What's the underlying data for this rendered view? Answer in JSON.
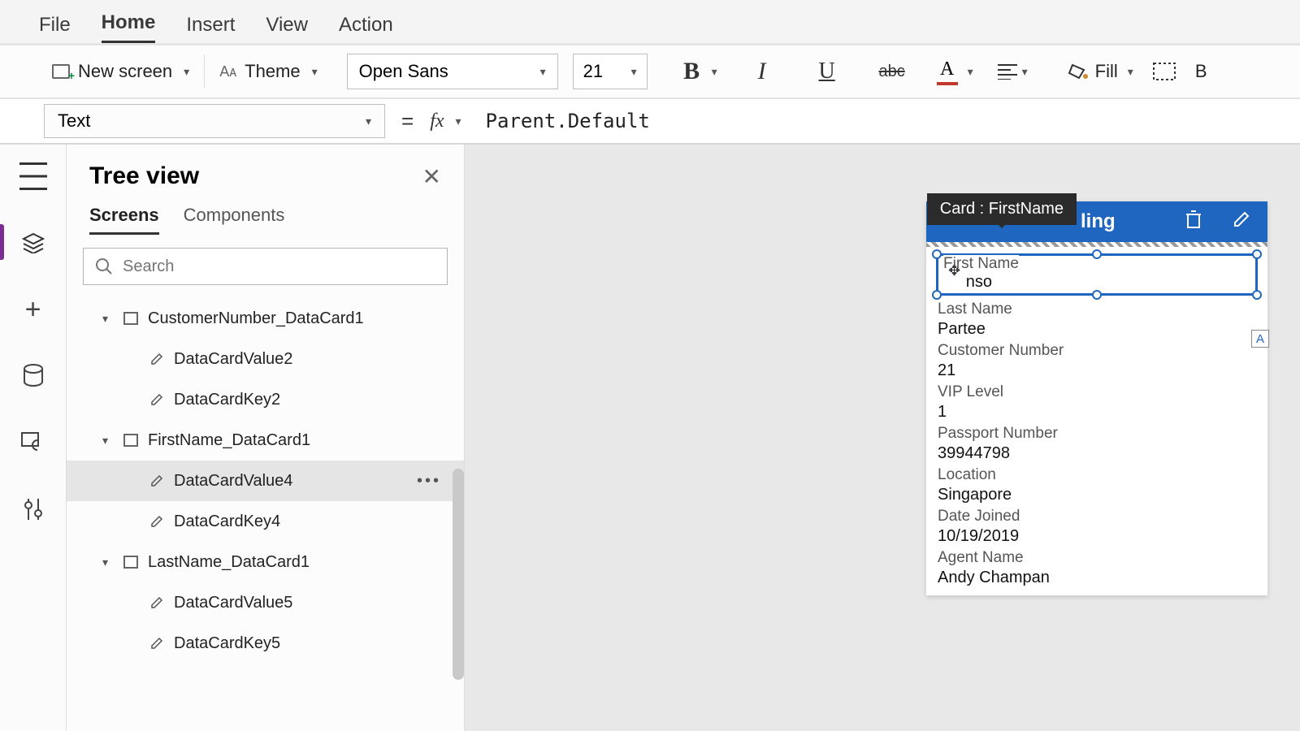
{
  "menu": {
    "file": "File",
    "home": "Home",
    "insert": "Insert",
    "view": "View",
    "action": "Action"
  },
  "toolbar": {
    "new_screen": "New screen",
    "theme": "Theme",
    "font": "Open Sans",
    "size": "21",
    "fill": "Fill"
  },
  "formula": {
    "property": "Text",
    "value": "Parent.Default"
  },
  "tree": {
    "title": "Tree view",
    "tab_screens": "Screens",
    "tab_components": "Components",
    "search_placeholder": "Search",
    "nodes": [
      {
        "level": 1,
        "label": "CustomerNumber_DataCard1",
        "type": "card",
        "expanded": true
      },
      {
        "level": 2,
        "label": "DataCardValue2",
        "type": "value"
      },
      {
        "level": 2,
        "label": "DataCardKey2",
        "type": "value"
      },
      {
        "level": 1,
        "label": "FirstName_DataCard1",
        "type": "card",
        "expanded": true
      },
      {
        "level": 2,
        "label": "DataCardValue4",
        "type": "value",
        "selected": true,
        "more": true
      },
      {
        "level": 2,
        "label": "DataCardKey4",
        "type": "value"
      },
      {
        "level": 1,
        "label": "LastName_DataCard1",
        "type": "card",
        "expanded": true
      },
      {
        "level": 2,
        "label": "DataCardValue5",
        "type": "value"
      },
      {
        "level": 2,
        "label": "DataCardKey5",
        "type": "value"
      }
    ]
  },
  "card_tooltip": "Card : FirstName",
  "form_header": {
    "title_fragment": "ling"
  },
  "form_fields": [
    {
      "label": "First Name",
      "value": "nso",
      "selected": true
    },
    {
      "label": "Last Name",
      "value": "Partee"
    },
    {
      "label": "Customer Number",
      "value": "21"
    },
    {
      "label": "VIP Level",
      "value": "1"
    },
    {
      "label": "Passport Number",
      "value": "39944798"
    },
    {
      "label": "Location",
      "value": "Singapore"
    },
    {
      "label": "Date Joined",
      "value": "10/19/2019"
    },
    {
      "label": "Agent Name",
      "value": "Andy Champan"
    }
  ],
  "a_badge": "A"
}
